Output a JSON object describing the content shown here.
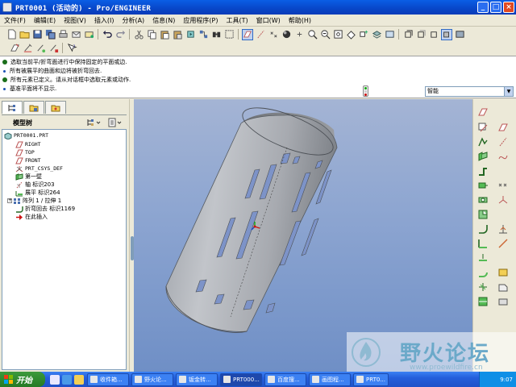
{
  "window": {
    "title": "PRT0001 (活动的) - Pro/ENGINEER"
  },
  "menu": [
    "文件(F)",
    "编辑(E)",
    "视图(V)",
    "插入(I)",
    "分析(A)",
    "信息(N)",
    "应用程序(P)",
    "工具(T)",
    "窗口(W)",
    "帮助(H)"
  ],
  "messages": [
    {
      "icon": "green",
      "text": "选取当前平/折弯面进行中保持固定的平面或边."
    },
    {
      "icon": "dot",
      "text": "所有被展平的曲面和边将被折弯回去."
    },
    {
      "icon": "green",
      "text": "所有元素已定义。请从对话框中选取元素或动作."
    },
    {
      "icon": "dot",
      "text": "基准平面将不显示."
    }
  ],
  "filter": {
    "value": "智能"
  },
  "model_tree": {
    "title": "模型树",
    "items": [
      {
        "label": "PRT0001.PRT",
        "icon": "part",
        "level": 0
      },
      {
        "label": "RIGHT",
        "icon": "plane",
        "level": 1
      },
      {
        "label": "TOP",
        "icon": "plane",
        "level": 1
      },
      {
        "label": "FRONT",
        "icon": "plane",
        "level": 1
      },
      {
        "label": "PRT_CSYS_DEF",
        "icon": "csys",
        "level": 1
      },
      {
        "label": "第一壁",
        "icon": "wall",
        "level": 1
      },
      {
        "label": "轴 标识203",
        "icon": "axis",
        "level": 1
      },
      {
        "label": "展平 标识264",
        "icon": "unbend",
        "level": 1
      },
      {
        "label": "阵列 1 / 拉伸 1",
        "icon": "pattern",
        "level": 1,
        "expandable": true
      },
      {
        "label": "折弯回去 标识1169",
        "icon": "bendback",
        "level": 1
      },
      {
        "label": "在此插入",
        "icon": "insert",
        "level": 1
      }
    ]
  },
  "watermark": {
    "text": "野火论坛",
    "url": "www.proewildfire.cn"
  },
  "taskbar": {
    "start": "开始",
    "tasks": [
      "收件箱...",
      "野火论...",
      "钣金转...",
      "PRT000...",
      "百度搜...",
      "画图程...",
      "PRT0..."
    ],
    "active_index": 3,
    "clock": "9:07"
  }
}
